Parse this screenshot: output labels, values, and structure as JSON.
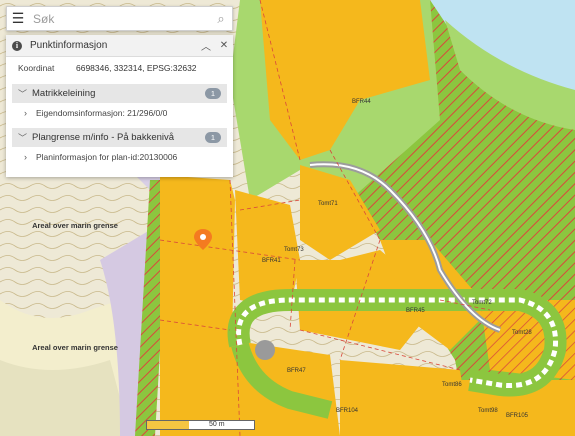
{
  "search": {
    "placeholder": "Søk",
    "menu_icon": "hamburger-menu-icon",
    "search_icon": "search-icon"
  },
  "panel": {
    "title": "Punktinformasjon",
    "coordinate_label": "Koordinat",
    "coordinate_value": "6698346, 332314, EPSG:32632",
    "sections": [
      {
        "label": "Matrikkeleining",
        "count": "1",
        "item": "Eigendomsinformasjon: 21/296/0/0"
      },
      {
        "label": "Plangrense m/info - På bakkenivå",
        "count": "1",
        "item": "Planinformasjon for plan-id:20130006"
      }
    ]
  },
  "map": {
    "area_labels": [
      "Areal over marin grense",
      "Areal over marin grense"
    ],
    "plot_labels": [
      "BFR44",
      "BFR41",
      "BFR45",
      "BFR47",
      "BFR104",
      "BFR105",
      "Tomt71",
      "Tomt72",
      "Tomt73",
      "Tomt28",
      "Tomt98",
      "Tomt86"
    ],
    "marker_icon": "location-pin-icon"
  },
  "scale": {
    "text": "50 m"
  },
  "colors": {
    "plot": "#f5b81c",
    "green": "#8cc63f",
    "forest": "#a8d86e",
    "hatch_red": "#d9483b",
    "marker": "#f47b20"
  }
}
